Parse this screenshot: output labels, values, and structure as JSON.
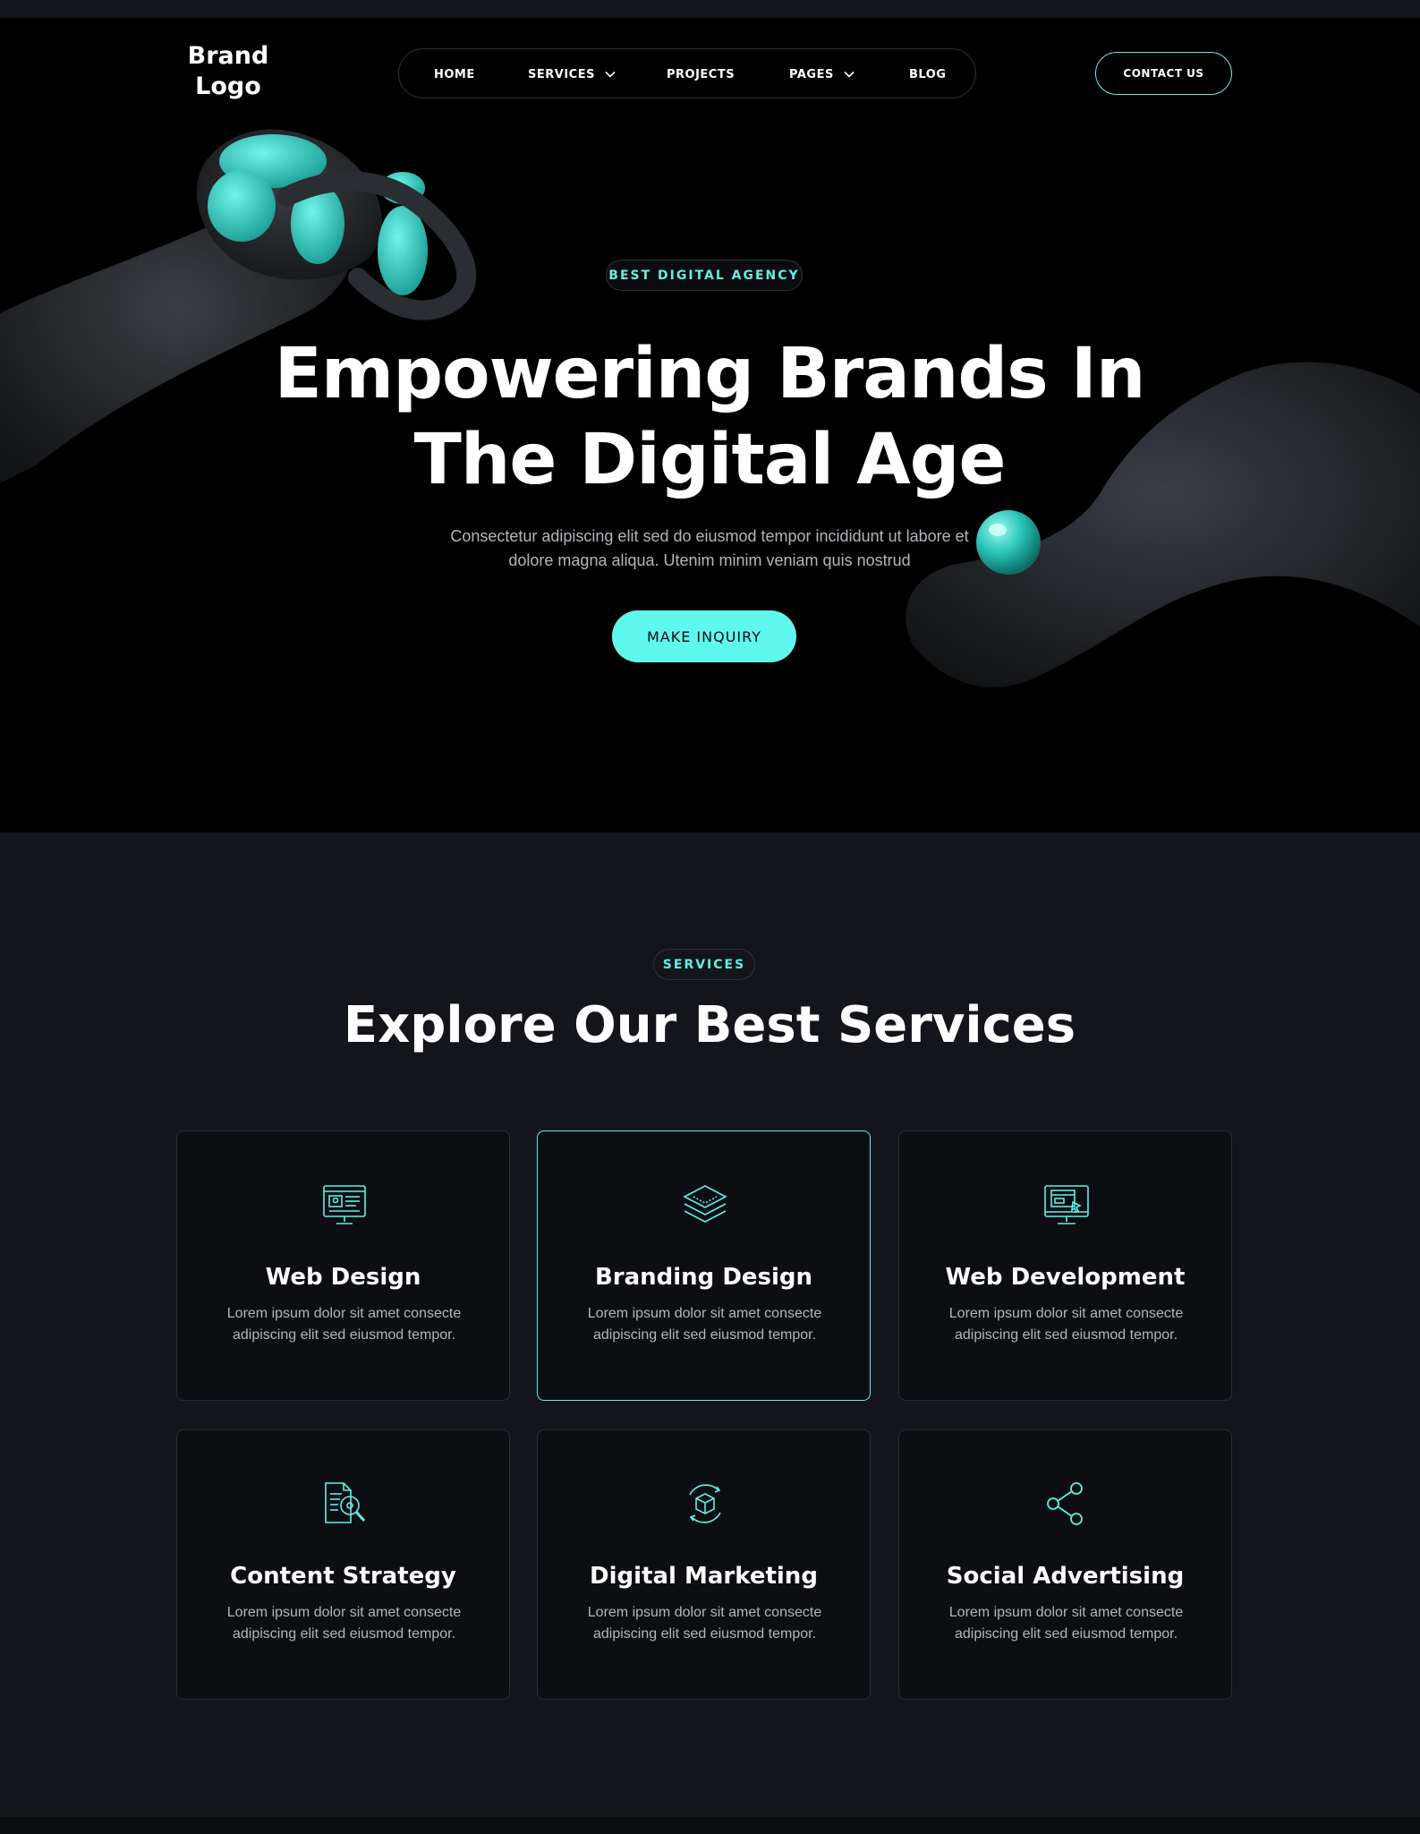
{
  "brand": {
    "logo_line1": "Brand",
    "logo_line2": "Logo"
  },
  "nav": {
    "items": [
      {
        "label": "HOME",
        "has_dropdown": false
      },
      {
        "label": "SERVICES",
        "has_dropdown": true
      },
      {
        "label": "PROJECTS",
        "has_dropdown": false
      },
      {
        "label": "PAGES",
        "has_dropdown": true
      },
      {
        "label": "BLOG",
        "has_dropdown": false
      }
    ],
    "contact_label": "CONTACT US"
  },
  "hero": {
    "eyebrow": "BEST DIGITAL AGENCY",
    "title_line1": "Empowering Brands In",
    "title_line2": "The Digital Age",
    "subtitle_line1": "Consectetur adipiscing elit sed do eiusmod tempor incididunt ut labore et",
    "subtitle_line2": "dolore magna aliqua. Utenim minim veniam quis nostrud",
    "cta_label": "MAKE INQUIRY"
  },
  "services": {
    "eyebrow": "SERVICES",
    "title": "Explore Our Best Services",
    "cards": [
      {
        "title": "Web Design",
        "desc_line1": "Lorem ipsum dolor sit amet consecte",
        "desc_line2": "adipiscing elit sed eiusmod tempor.",
        "icon": "web-design-icon"
      },
      {
        "title": "Branding Design",
        "desc_line1": "Lorem ipsum dolor sit amet consecte",
        "desc_line2": "adipiscing elit sed eiusmod tempor.",
        "icon": "layers-icon"
      },
      {
        "title": "Web Development",
        "desc_line1": "Lorem ipsum dolor sit amet consecte",
        "desc_line2": "adipiscing elit sed eiusmod tempor.",
        "icon": "monitor-code-icon"
      },
      {
        "title": "Content Strategy",
        "desc_line1": "Lorem ipsum dolor sit amet consecte",
        "desc_line2": "adipiscing elit sed eiusmod tempor.",
        "icon": "document-search-icon"
      },
      {
        "title": "Digital Marketing",
        "desc_line1": "Lorem ipsum dolor sit amet consecte",
        "desc_line2": "adipiscing elit sed eiusmod tempor.",
        "icon": "cube-cycle-icon"
      },
      {
        "title": "Social Advertising",
        "desc_line1": "Lorem ipsum dolor sit amet consecte",
        "desc_line2": "adipiscing elit sed eiusmod tempor.",
        "icon": "share-icon"
      }
    ]
  },
  "colors": {
    "accent": "#5ff0e6",
    "page_bg": "#13151a",
    "hero_bg": "#000000",
    "card_bg": "#0d0e12"
  }
}
